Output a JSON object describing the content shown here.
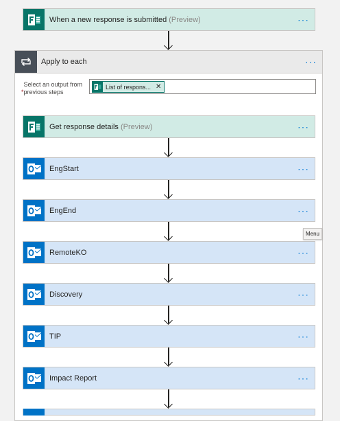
{
  "trigger": {
    "title": "When a new response is submitted",
    "tag": "(Preview)",
    "icon": "forms-icon"
  },
  "apply_to_each": {
    "title": "Apply to each",
    "icon": "loop-icon",
    "output_label_required": "*",
    "output_label": "Select an output from previous steps",
    "token_label": "List of respons...",
    "token_close": "✕"
  },
  "steps": [
    {
      "title": "Get response details",
      "tag": "(Preview)",
      "icon": "forms-icon"
    },
    {
      "title": "EngStart",
      "icon": "outlook-icon"
    },
    {
      "title": "EngEnd",
      "icon": "outlook-icon"
    },
    {
      "title": "RemoteKO",
      "icon": "outlook-icon"
    },
    {
      "title": "Discovery",
      "icon": "outlook-icon"
    },
    {
      "title": "TIP",
      "icon": "outlook-icon"
    },
    {
      "title": "Impact Report",
      "icon": "outlook-icon"
    }
  ],
  "more_label": "···",
  "tooltip": "Menu",
  "colors": {
    "forms_green": "#077568",
    "forms_card": "#d1ebe5",
    "outlook_blue": "#0072c6",
    "outlook_card": "#d5e5f7",
    "link_blue": "#0078d4"
  }
}
